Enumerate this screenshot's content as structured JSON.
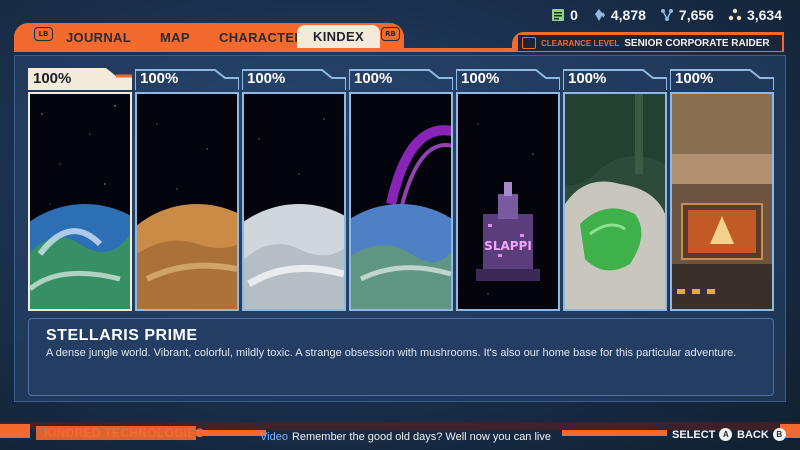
{
  "resources": [
    {
      "icon": "document-icon",
      "value": "0"
    },
    {
      "icon": "crystal-icon",
      "value": "4,878"
    },
    {
      "icon": "molecule-icon",
      "value": "7,656"
    },
    {
      "icon": "atom-cluster-icon",
      "value": "3,634"
    }
  ],
  "tabs": {
    "lb": "LB",
    "rb": "RB",
    "journal": "JOURNAL",
    "map": "MAP",
    "character": "CHARACTER",
    "kindex": "KINDEX"
  },
  "clearance": {
    "label": "CLEARANCE LEVEL",
    "value": "SENIOR CORPORATE RAIDER"
  },
  "cards": [
    {
      "percent": "100%",
      "subject": "blue-green planet",
      "selected": true
    },
    {
      "percent": "100%",
      "subject": "desert planet"
    },
    {
      "percent": "100%",
      "subject": "ice planet"
    },
    {
      "percent": "100%",
      "subject": "planet with purple rings"
    },
    {
      "percent": "100%",
      "subject": "SLAPPI space station",
      "sign": "SLAPPI"
    },
    {
      "percent": "100%",
      "subject": "green crystal crater"
    },
    {
      "percent": "100%",
      "subject": "corporate office interior"
    }
  ],
  "details": {
    "name": "STELLARIS PRIME",
    "description": "A dense jungle world. Vibrant, colorful, mildly toxic. A strange obsession with mushrooms. It's also our home base for this particular adventure."
  },
  "footer": {
    "brand": "KINDRED TECHNOLOGIES",
    "ticker_tag": "Video",
    "ticker_text": "Remember the good old days? Well now you can live",
    "select_label": "SELECT",
    "select_button": "A",
    "back_label": "BACK",
    "back_button": "B"
  },
  "colors": {
    "accent": "#f26a2e",
    "panel": "#243e63",
    "cream": "#f3ead9"
  }
}
